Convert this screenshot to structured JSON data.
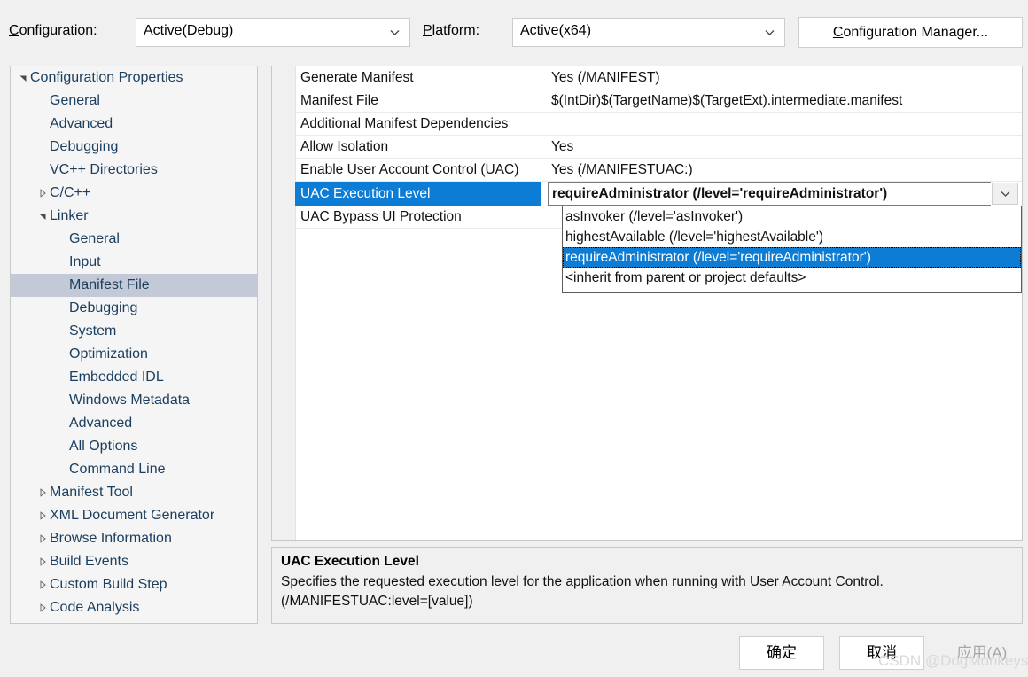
{
  "header": {
    "configuration_label": "Configuration:",
    "configuration_value": "Active(Debug)",
    "platform_label": "Platform:",
    "platform_value": "Active(x64)",
    "configuration_manager_button": "Configuration Manager..."
  },
  "tree": {
    "items": [
      {
        "label": "Configuration Properties",
        "indent": 0,
        "marker": "expanded",
        "selected": false
      },
      {
        "label": "General",
        "indent": 1,
        "marker": "none",
        "selected": false
      },
      {
        "label": "Advanced",
        "indent": 1,
        "marker": "none",
        "selected": false
      },
      {
        "label": "Debugging",
        "indent": 1,
        "marker": "none",
        "selected": false
      },
      {
        "label": "VC++ Directories",
        "indent": 1,
        "marker": "none",
        "selected": false
      },
      {
        "label": "C/C++",
        "indent": 1,
        "marker": "collapsed",
        "selected": false
      },
      {
        "label": "Linker",
        "indent": 1,
        "marker": "expanded",
        "selected": false
      },
      {
        "label": "General",
        "indent": 2,
        "marker": "none",
        "selected": false
      },
      {
        "label": "Input",
        "indent": 2,
        "marker": "none",
        "selected": false
      },
      {
        "label": "Manifest File",
        "indent": 2,
        "marker": "none",
        "selected": true
      },
      {
        "label": "Debugging",
        "indent": 2,
        "marker": "none",
        "selected": false
      },
      {
        "label": "System",
        "indent": 2,
        "marker": "none",
        "selected": false
      },
      {
        "label": "Optimization",
        "indent": 2,
        "marker": "none",
        "selected": false
      },
      {
        "label": "Embedded IDL",
        "indent": 2,
        "marker": "none",
        "selected": false
      },
      {
        "label": "Windows Metadata",
        "indent": 2,
        "marker": "none",
        "selected": false
      },
      {
        "label": "Advanced",
        "indent": 2,
        "marker": "none",
        "selected": false
      },
      {
        "label": "All Options",
        "indent": 2,
        "marker": "none",
        "selected": false
      },
      {
        "label": "Command Line",
        "indent": 2,
        "marker": "none",
        "selected": false
      },
      {
        "label": "Manifest Tool",
        "indent": 1,
        "marker": "collapsed",
        "selected": false
      },
      {
        "label": "XML Document Generator",
        "indent": 1,
        "marker": "collapsed",
        "selected": false
      },
      {
        "label": "Browse Information",
        "indent": 1,
        "marker": "collapsed",
        "selected": false
      },
      {
        "label": "Build Events",
        "indent": 1,
        "marker": "collapsed",
        "selected": false
      },
      {
        "label": "Custom Build Step",
        "indent": 1,
        "marker": "collapsed",
        "selected": false
      },
      {
        "label": "Code Analysis",
        "indent": 1,
        "marker": "collapsed",
        "selected": false
      }
    ]
  },
  "grid": {
    "rows": [
      {
        "name": "Generate Manifest",
        "value": "Yes (/MANIFEST)",
        "state": "normal"
      },
      {
        "name": "Manifest File",
        "value": "$(IntDir)$(TargetName)$(TargetExt).intermediate.manifest",
        "state": "normal"
      },
      {
        "name": "Additional Manifest Dependencies",
        "value": "",
        "state": "normal"
      },
      {
        "name": "Allow Isolation",
        "value": "Yes",
        "state": "normal"
      },
      {
        "name": "Enable User Account Control (UAC)",
        "value": "Yes (/MANIFESTUAC:)",
        "state": "normal"
      },
      {
        "name": "UAC Execution Level",
        "value": "requireAdministrator (/level='requireAdministrator')",
        "state": "editing"
      },
      {
        "name": "UAC Bypass UI Protection",
        "value": "",
        "state": "normal"
      }
    ]
  },
  "dropdown": {
    "options": [
      {
        "label": "asInvoker (/level='asInvoker')",
        "selected": false
      },
      {
        "label": "highestAvailable (/level='highestAvailable')",
        "selected": false
      },
      {
        "label": "requireAdministrator (/level='requireAdministrator')",
        "selected": true
      },
      {
        "label": "<inherit from parent or project defaults>",
        "selected": false
      }
    ]
  },
  "description": {
    "title": "UAC Execution Level",
    "body": "Specifies the requested execution level for the application when running with User Account Control.  (/MANIFESTUAC:level=[value])"
  },
  "footer": {
    "ok": "确定",
    "cancel": "取消",
    "apply": "应用(A)"
  },
  "watermark": "CSDN @DogMonkeys",
  "colors": {
    "selection_blue": "#0c7cd5",
    "tree_selection": "#c3c9d6",
    "dialog_background": "#f0f0f0",
    "tree_text": "#1c3f60"
  }
}
